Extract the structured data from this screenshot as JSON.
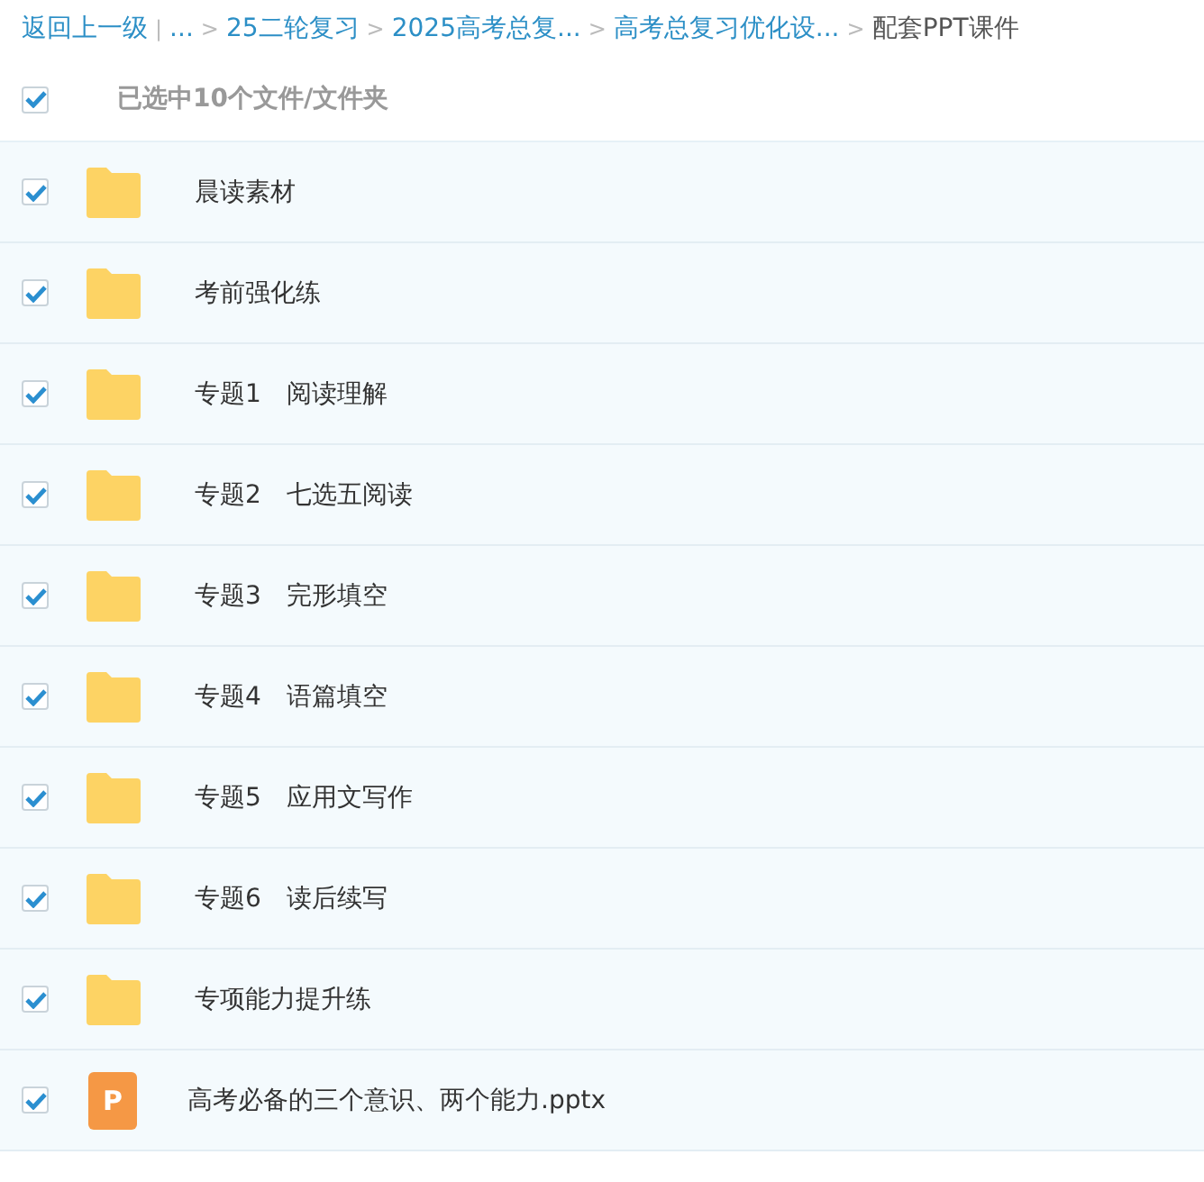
{
  "breadcrumb": {
    "back": "返回上一级",
    "divider": "|",
    "items": [
      {
        "label": "...",
        "current": false
      },
      {
        "label": "25二轮复习",
        "separator": ">",
        "current": false
      },
      {
        "label": "2025高考总复...",
        "separator": ">",
        "current": false
      },
      {
        "label": "高考总复习优化设...",
        "separator": ">",
        "current": false
      },
      {
        "label": "配套PPT课件",
        "separator": ">",
        "current": true
      }
    ]
  },
  "selection": {
    "checked": true,
    "label": "已选中10个文件/文件夹"
  },
  "files": [
    {
      "kind": "folder",
      "name": "晨读素材",
      "checked": true
    },
    {
      "kind": "folder",
      "name": "考前强化练",
      "checked": true
    },
    {
      "kind": "folder",
      "name": "专题1　阅读理解",
      "checked": true
    },
    {
      "kind": "folder",
      "name": "专题2　七选五阅读",
      "checked": true
    },
    {
      "kind": "folder",
      "name": "专题3　完形填空",
      "checked": true
    },
    {
      "kind": "folder",
      "name": "专题4　语篇填空",
      "checked": true
    },
    {
      "kind": "folder",
      "name": "专题5　应用文写作",
      "checked": true
    },
    {
      "kind": "folder",
      "name": "专题6　读后续写",
      "checked": true
    },
    {
      "kind": "folder",
      "name": "专项能力提升练",
      "checked": true
    },
    {
      "kind": "pptx",
      "name": "高考必备的三个意识、两个能力.pptx",
      "checked": true,
      "icon_letter": "P"
    }
  ]
}
